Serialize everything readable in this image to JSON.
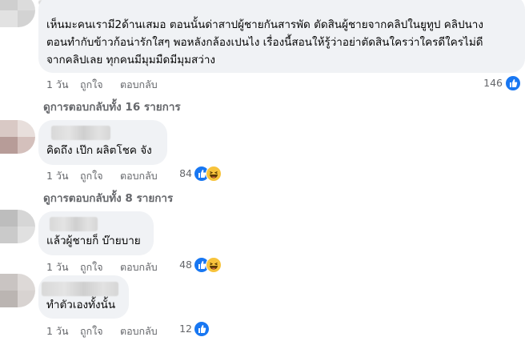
{
  "comments": [
    {
      "lines": [
        "เห็นมะคนเรามี2ด้านเสมอ ตอนนั้นด่าสาปผู้ชายกันสารพัด ตัดสินผู้ชายจากคลิปในยูทูป คลิปนาง",
        "ตอนทำกับข้าวก้อน่ารักใสๆ พอหลังกล้องเปนไง เรื่องนี้สอนให้รู้ว่าอย่าตัดสินใครว่าใครดีใครไม่ดี",
        "จากคลิปเลย ทุกคนมีมุมมืดมีมุมสว่าง"
      ],
      "time": "1 วัน",
      "like_label": "ถูกใจ",
      "reply_label": "ตอบกลับ",
      "reaction_count": "146",
      "reactions": [
        "like-icon"
      ],
      "replies_label": "ดูการตอบกลับทั้ง 16 รายการ"
    },
    {
      "lines": [
        "คิดถึง เป๊ก ผลิตโชค จัง"
      ],
      "time": "1 วัน",
      "like_label": "ถูกใจ",
      "reply_label": "ตอบกลับ",
      "reaction_count": "84",
      "reactions": [
        "like-icon",
        "haha-icon"
      ],
      "replies_label": "ดูการตอบกลับทั้ง 8 รายการ"
    },
    {
      "lines": [
        "แล้วผู้ชายก็ บ๊ายบาย"
      ],
      "time": "1 วัน",
      "like_label": "ถูกใจ",
      "reply_label": "ตอบกลับ",
      "reaction_count": "48",
      "reactions": [
        "like-icon",
        "haha-icon"
      ]
    },
    {
      "lines": [
        "ทำตัวเองทั้งนั้น"
      ],
      "time": "1 วัน",
      "like_label": "ถูกใจ",
      "reply_label": "ตอบกลับ",
      "reaction_count": "12",
      "reactions": [
        "like-icon"
      ]
    }
  ],
  "colors": {
    "bubble": "#f0f2f5",
    "secondary_text": "#65676b",
    "like_blue": "#1877f2",
    "haha_yellow": "#f7c33c"
  }
}
